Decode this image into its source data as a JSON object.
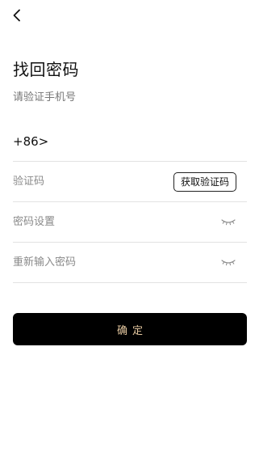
{
  "header": {
    "back_icon": "chevron-left-icon",
    "title": "找回密码",
    "subtitle": "请验证手机号"
  },
  "form": {
    "phone": {
      "prefix": "+86>",
      "value": ""
    },
    "code": {
      "placeholder": "验证码",
      "button_label": "获取验证码"
    },
    "password": {
      "placeholder": "密码设置",
      "toggle_icon": "eye-closed-icon"
    },
    "confirm_password": {
      "placeholder": "重新输入密码",
      "toggle_icon": "eye-closed-icon"
    }
  },
  "actions": {
    "confirm_label": "确定"
  },
  "colors": {
    "background": "#ffffff",
    "primary_button": "#000000",
    "primary_button_text": "#e5c8a0",
    "divider": "#e2e2e2",
    "placeholder": "#8a8a8a"
  }
}
